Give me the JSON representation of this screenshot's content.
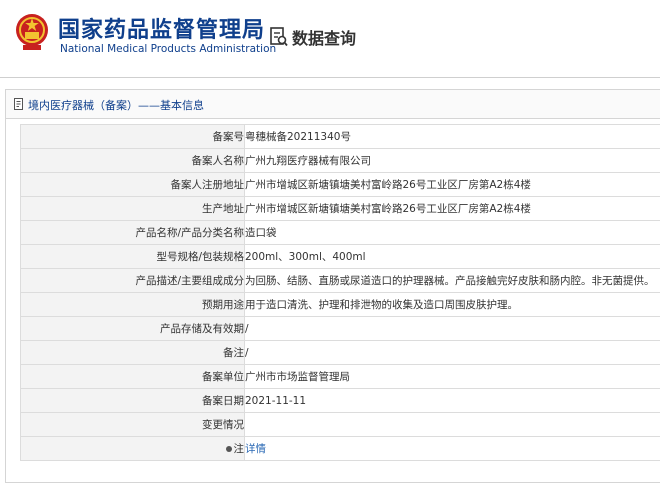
{
  "header": {
    "title_cn": "国家药品监督管理局",
    "title_en": "National Medical Products Administration",
    "query_label": "数据查询"
  },
  "breadcrumb": "境内医疗器械（备案）——基本信息",
  "rows": [
    {
      "label": "备案号",
      "value": "粤穗械备20211340号"
    },
    {
      "label": "备案人名称",
      "value": "广州九翔医疗器械有限公司"
    },
    {
      "label": "备案人注册地址",
      "value": "广州市增城区新塘镇塘美村富岭路26号工业区厂房第A2栋4楼"
    },
    {
      "label": "生产地址",
      "value": "广州市增城区新塘镇塘美村富岭路26号工业区厂房第A2栋4楼"
    },
    {
      "label": "产品名称/产品分类名称",
      "value": "造口袋"
    },
    {
      "label": "型号规格/包装规格",
      "value": "200ml、300ml、400ml"
    },
    {
      "label": "产品描述/主要组成成分",
      "value": "为回肠、结肠、直肠或尿道造口的护理器械。产品接触完好皮肤和肠内腔。非无菌提供。"
    },
    {
      "label": "预期用途",
      "value": "用于造口清洗、护理和排泄物的收集及造口周围皮肤护理。"
    },
    {
      "label": "产品存储及有效期",
      "value": "/"
    },
    {
      "label": "备注",
      "value": "/"
    },
    {
      "label": "备案单位",
      "value": "广州市市场监督管理局"
    },
    {
      "label": "备案日期",
      "value": "2021-11-11"
    },
    {
      "label": "变更情况",
      "value": ""
    }
  ],
  "note_row": {
    "label": "注",
    "link": "详情"
  },
  "icons": {
    "emblem": "national-emblem-icon",
    "query": "search-document-icon",
    "breadcrumb": "document-icon",
    "note": "pin-icon"
  },
  "colors": {
    "brand_blue": "#0f3f8c",
    "link_blue": "#2a69b5",
    "label_bg": "#f3f3f3"
  }
}
